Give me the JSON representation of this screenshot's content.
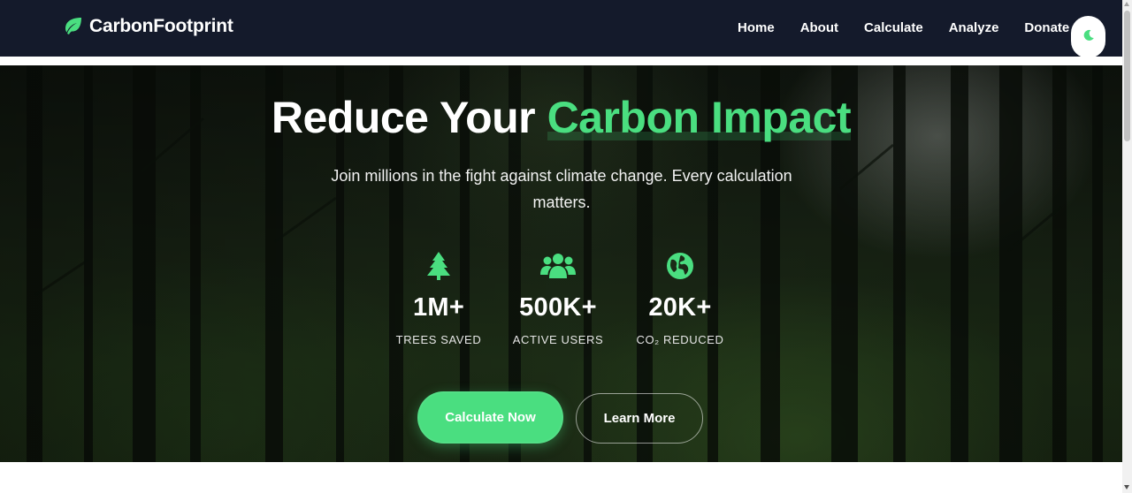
{
  "navbar": {
    "brand": "CarbonFootprint",
    "brand_icon": "leaf-icon",
    "links": [
      {
        "label": "Home"
      },
      {
        "label": "About"
      },
      {
        "label": "Calculate"
      },
      {
        "label": "Analyze"
      },
      {
        "label": "Donate"
      }
    ],
    "theme_toggle_icon": "moon-icon"
  },
  "hero": {
    "title_main": "Reduce Your",
    "title_accent": "Carbon Impact",
    "subtitle": "Join millions in the fight against climate change. Every calculation matters.",
    "stats": [
      {
        "icon": "tree-icon",
        "value": "1M+",
        "label": "TREES SAVED"
      },
      {
        "icon": "users-icon",
        "value": "500K+",
        "label": "ACTIVE USERS"
      },
      {
        "icon": "globe-icon",
        "value": "20K+",
        "label": "CO₂ REDUCED"
      }
    ],
    "primary_button": "Calculate Now",
    "secondary_button": "Learn More"
  },
  "colors": {
    "accent": "#4ade80",
    "navbar_bg": "#141a2b",
    "text_light": "#ffffff"
  }
}
